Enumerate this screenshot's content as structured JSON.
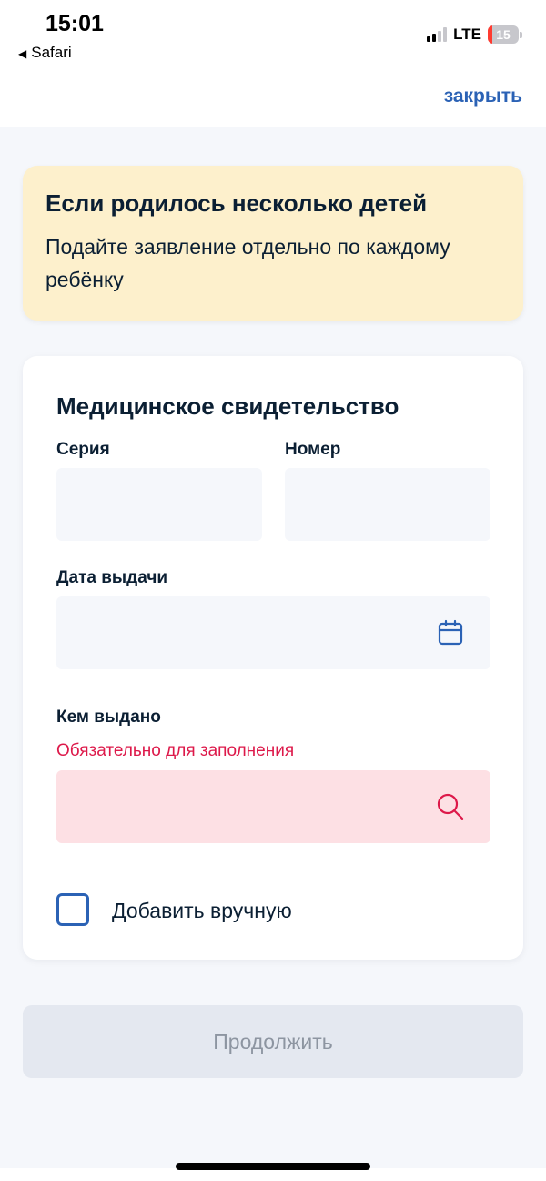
{
  "status_bar": {
    "time": "15:01",
    "back_app": "Safari",
    "network": "LTE",
    "battery_percent": "15",
    "battery_level": 0.15
  },
  "header": {
    "close_label": "закрыть"
  },
  "notice": {
    "title": "Если родилось несколько детей",
    "text": "Подайте заявление отдельно по каждому ребёнку",
    "background_color": "#fdf0cc"
  },
  "form": {
    "title": "Медицинское свидетельство",
    "series_label": "Серия",
    "number_label": "Номер",
    "date_label": "Дата выдачи",
    "issued_by_label": "Кем выдано",
    "issued_by_error": "Обязательно для заполнения",
    "manual_checkbox_label": "Добавить вручную",
    "manual_checked": false,
    "icons": {
      "date": "calendar-icon",
      "issued_by": "search-icon"
    }
  },
  "actions": {
    "continue_label": "Продолжить"
  },
  "colors": {
    "accent": "#2b62b5",
    "error": "#dd194a",
    "error_field_bg": "#fde0e4",
    "disabled_button_bg": "#e4e8f0"
  }
}
